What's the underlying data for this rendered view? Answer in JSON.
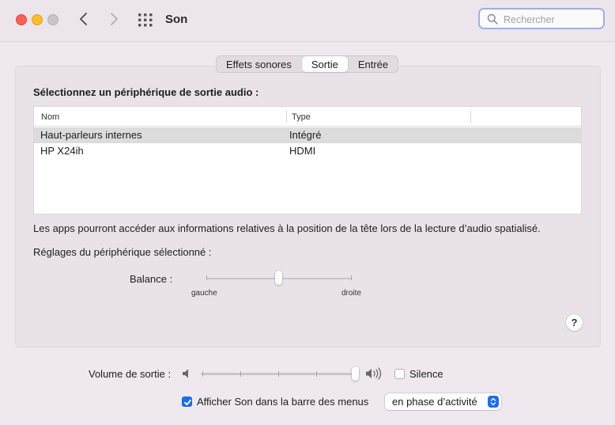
{
  "window": {
    "title": "Son",
    "search_placeholder": "Rechercher"
  },
  "tabs": [
    {
      "label": "Effets sonores",
      "active": false
    },
    {
      "label": "Sortie",
      "active": true
    },
    {
      "label": "Entrée",
      "active": false
    }
  ],
  "output": {
    "section_title": "Sélectionnez un périphérique de sortie audio :",
    "columns": [
      "Nom",
      "Type"
    ],
    "devices": [
      {
        "name": "Haut-parleurs internes",
        "type": "Intégré",
        "selected": true
      },
      {
        "name": "HP X24ih",
        "type": "HDMI",
        "selected": false
      }
    ],
    "info_text": "Les apps pourront accéder aux informations relatives à la position de la tête lors de la lecture d’audio spatialisé.",
    "settings_label": "Réglages du périphérique sélectionné :",
    "balance": {
      "label": "Balance :",
      "left_label": "gauche",
      "right_label": "droite",
      "value": 0.5
    },
    "help_label": "?"
  },
  "volume": {
    "label": "Volume de sortie :",
    "value": 1.0,
    "mute_label": "Silence",
    "mute_checked": false
  },
  "menubar": {
    "label": "Afficher Son dans la barre des menus",
    "checked": true,
    "select_value": "en phase d’activité"
  },
  "colors": {
    "accent": "#1b6ef3",
    "close": "#fe5f57",
    "minimize": "#febc2e",
    "zoom_disabled": "#c9c3c9"
  }
}
